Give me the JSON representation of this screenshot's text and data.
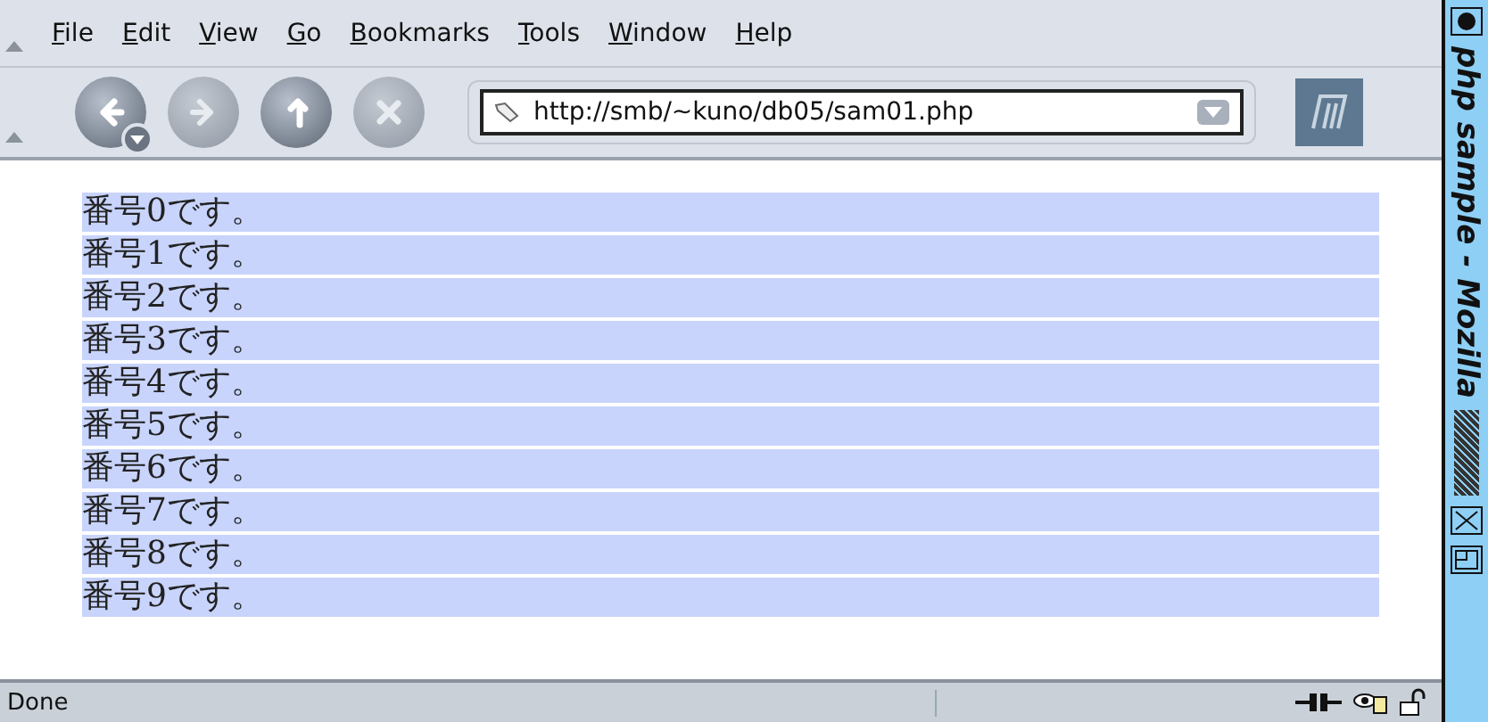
{
  "menu": [
    "File",
    "Edit",
    "View",
    "Go",
    "Bookmarks",
    "Tools",
    "Window",
    "Help"
  ],
  "toolbar": {
    "buttons": [
      {
        "kind": "back",
        "disabled": false
      },
      {
        "kind": "forward",
        "disabled": true
      },
      {
        "kind": "reload",
        "disabled": false
      },
      {
        "kind": "stop",
        "disabled": true
      }
    ],
    "url": "http://smb/~kuno/db05/sam01.php"
  },
  "rows": [
    "番号0です。",
    "番号1です。",
    "番号2です。",
    "番号3です。",
    "番号4です。",
    "番号5です。",
    "番号6です。",
    "番号7です。",
    "番号8です。",
    "番号9です。"
  ],
  "status_bar": {
    "text": "Done"
  },
  "side_title": "php sample - Mozilla"
}
